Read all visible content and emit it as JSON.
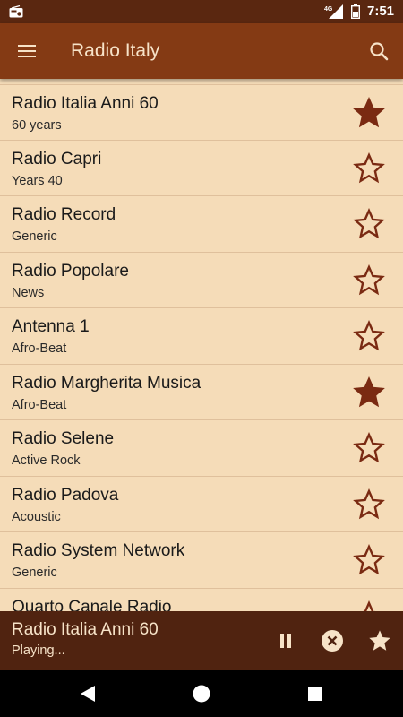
{
  "status_bar": {
    "network": "4G",
    "time": "7:51"
  },
  "app_bar": {
    "title": "Radio Italy",
    "menu_icon": "menu-icon",
    "search_icon": "search-icon"
  },
  "stations": [
    {
      "name": "Radio Italia Anni 60",
      "genre": "60 years",
      "favorite": true
    },
    {
      "name": "Radio Capri",
      "genre": "Years 40",
      "favorite": false
    },
    {
      "name": "Radio Record",
      "genre": "Generic",
      "favorite": false
    },
    {
      "name": "Radio Popolare",
      "genre": "News",
      "favorite": false
    },
    {
      "name": "Antenna 1",
      "genre": "Afro-Beat",
      "favorite": false
    },
    {
      "name": "Radio Margherita Musica",
      "genre": "Afro-Beat",
      "favorite": true
    },
    {
      "name": "Radio Selene",
      "genre": "Active Rock",
      "favorite": false
    },
    {
      "name": "Radio Padova",
      "genre": "Acoustic",
      "favorite": false
    },
    {
      "name": "Radio System Network",
      "genre": "Generic",
      "favorite": false
    },
    {
      "name": "Quarto Canale Radio",
      "genre": "",
      "favorite": false
    }
  ],
  "player": {
    "title": "Radio Italia Anni 60",
    "status": "Playing..."
  },
  "colors": {
    "status_bar": "#5a2710",
    "app_bar": "#843a14",
    "list_bg": "#f5dcb8",
    "star": "#7a2a12",
    "player_bg": "#502310",
    "player_text": "#f7e3c8"
  }
}
